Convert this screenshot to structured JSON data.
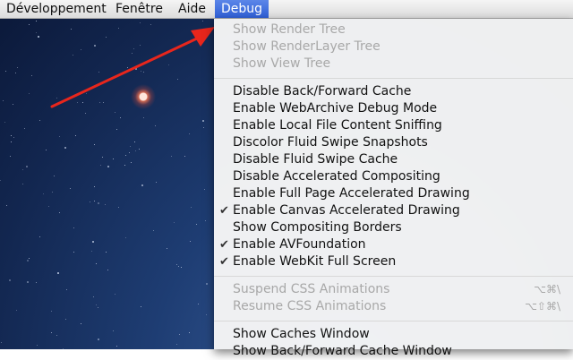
{
  "menubar": {
    "items": [
      "Développement",
      "Fenêtre",
      "Aide",
      "Debug"
    ],
    "active": "Debug"
  },
  "debug_menu": {
    "group1": [
      {
        "label": "Show Render Tree",
        "enabled": false
      },
      {
        "label": "Show RenderLayer Tree",
        "enabled": false
      },
      {
        "label": "Show View Tree",
        "enabled": false
      }
    ],
    "group2": [
      {
        "label": "Disable Back/Forward Cache",
        "checked": false
      },
      {
        "label": "Enable WebArchive Debug Mode",
        "checked": false
      },
      {
        "label": "Enable Local File Content Sniffing",
        "checked": false
      },
      {
        "label": "Discolor Fluid Swipe Snapshots",
        "checked": false
      },
      {
        "label": "Disable Fluid Swipe Cache",
        "checked": false
      },
      {
        "label": "Disable Accelerated Compositing",
        "checked": false
      },
      {
        "label": "Enable Full Page Accelerated Drawing",
        "checked": false
      },
      {
        "label": "Enable Canvas Accelerated Drawing",
        "checked": true
      },
      {
        "label": "Show Compositing Borders",
        "checked": false
      },
      {
        "label": "Enable AVFoundation",
        "checked": true
      },
      {
        "label": "Enable WebKit Full Screen",
        "checked": true
      }
    ],
    "group3": [
      {
        "label": "Suspend CSS Animations",
        "shortcut": "⌥⌘\\",
        "enabled": false
      },
      {
        "label": "Resume CSS Animations",
        "shortcut": "⌥⇧⌘\\",
        "enabled": false
      }
    ],
    "group4": [
      {
        "label": "Show Caches Window"
      },
      {
        "label": "Show Back/Forward Cache Window"
      }
    ],
    "check_glyph": "✔"
  },
  "colors": {
    "menubar_highlight": "#3b6ee0",
    "annotation_arrow": "#e8261c",
    "disabled_text": "#a8a8a8"
  }
}
